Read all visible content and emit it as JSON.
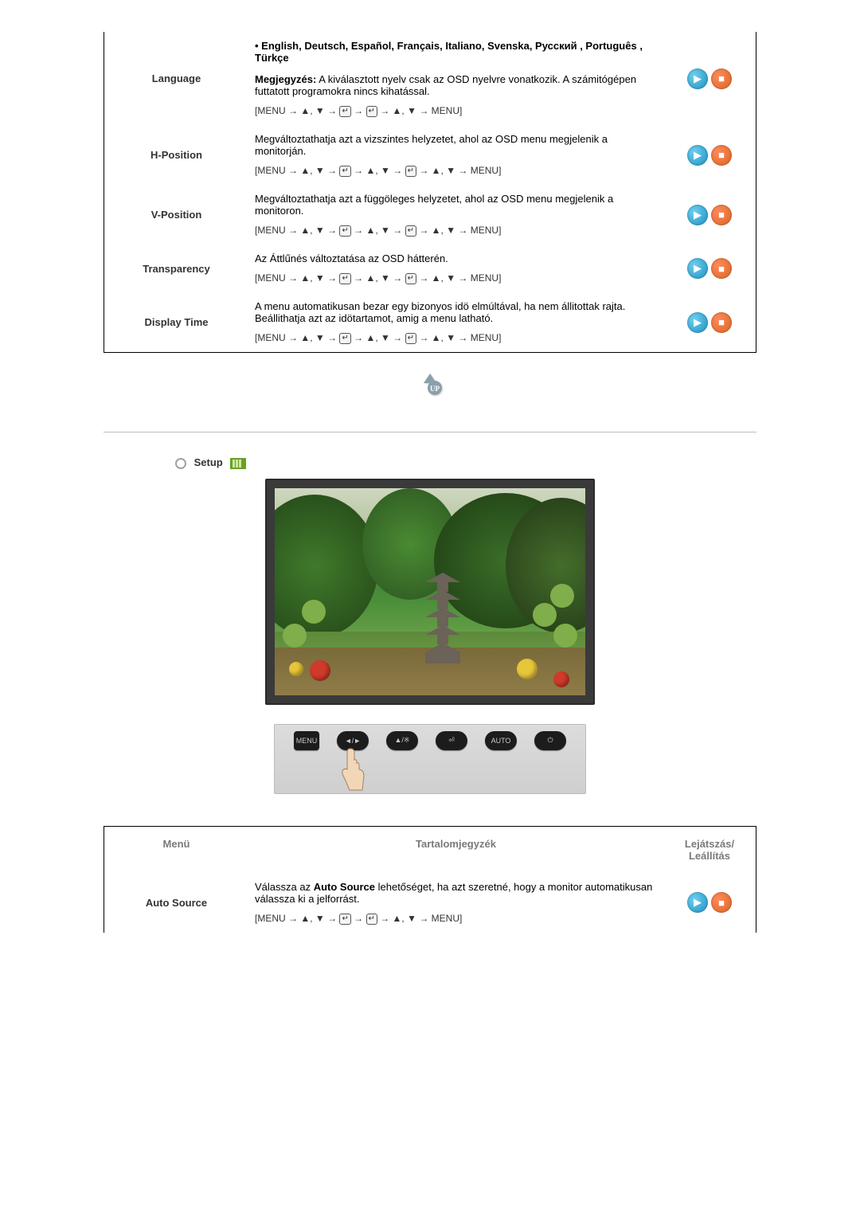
{
  "column_headers": {
    "menu": "Menü",
    "content": "Tartalomjegyzék",
    "play": "Lejátszás/ Leállítás"
  },
  "rows1": [
    {
      "key": "language",
      "label": "Language",
      "bullet": "English, Deutsch, Español, Français,  Italiano, Svenska, Русский , Português , Türkçe",
      "note_label": "Megjegyzés:",
      "note_text": " A kiválasztott nyelv csak az OSD nyelvre vonatkozik. A számitógépen futtatott programokra nincs kihatással.",
      "nav_open": "[MENU → ",
      "nav_close": " → MENU]"
    },
    {
      "key": "hposition",
      "label": "H-Position",
      "text": "Megváltoztathatja azt a vizszintes helyzetet, ahol az OSD menu megjelenik a monitorján.",
      "nav_open": "[MENU → ",
      "nav_close": " → MENU]"
    },
    {
      "key": "vposition",
      "label": "V-Position",
      "text": "Megváltoztathatja azt a függöleges helyzetet, ahol az OSD menu megjelenik a monitoron.",
      "nav_open": "[MENU → ",
      "nav_close": " → MENU]"
    },
    {
      "key": "transparency",
      "label": "Transparency",
      "text": "Az Áttlűnés változtatása az OSD hátterén.",
      "nav_open": "[MENU → ",
      "nav_close": " → MENU]"
    },
    {
      "key": "displaytime",
      "label": "Display Time",
      "text": "A menu automatikusan bezar egy bizonyos idö elmúltával, ha nem állitottak rajta.\nBeállithatja azt az idötartamot, amig a menu latható.",
      "nav_open": "[MENU → ",
      "nav_close": " → MENU]"
    }
  ],
  "up_label": "UP",
  "setup_title": "Setup",
  "buttons_bar": {
    "b1": "MENU",
    "b2": "◄/►",
    "b3": "▲/※",
    "b4": "⏎",
    "b5": "AUTO",
    "b6": "⏻"
  },
  "rows2": [
    {
      "key": "autosource",
      "label": "Auto Source",
      "text_pre": "Válassza az ",
      "text_bold": "Auto Source",
      "text_post": " lehetőséget, ha azt szeretné, hogy a monitor automatikusan válassza ki a jelforrást.",
      "nav_open": "[MENU → ",
      "nav_close": " → MENU]"
    }
  ]
}
